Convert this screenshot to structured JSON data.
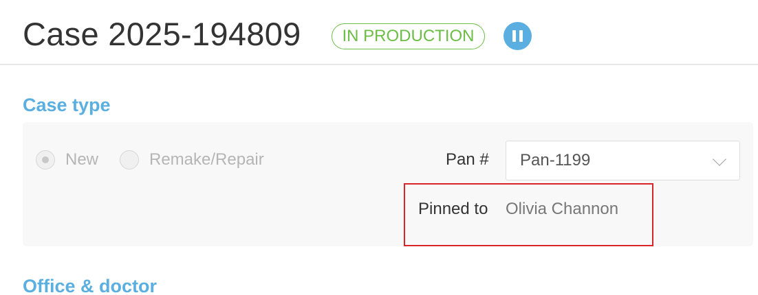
{
  "header": {
    "title": "Case 2025-194809",
    "status": "IN PRODUCTION",
    "status_color": "#6cbd45",
    "pause_icon": "pause-icon",
    "accent_color": "#5aafe0"
  },
  "case_type": {
    "heading": "Case type",
    "options": [
      {
        "label": "New",
        "selected": true
      },
      {
        "label": "Remake/Repair",
        "selected": false
      }
    ],
    "pan_label": "Pan #",
    "pan_value": "Pan-1199",
    "pinned_label": "Pinned to",
    "pinned_value": "Olivia Channon",
    "highlight_color": "#d9242b"
  },
  "office_doctor": {
    "heading": "Office & doctor"
  }
}
